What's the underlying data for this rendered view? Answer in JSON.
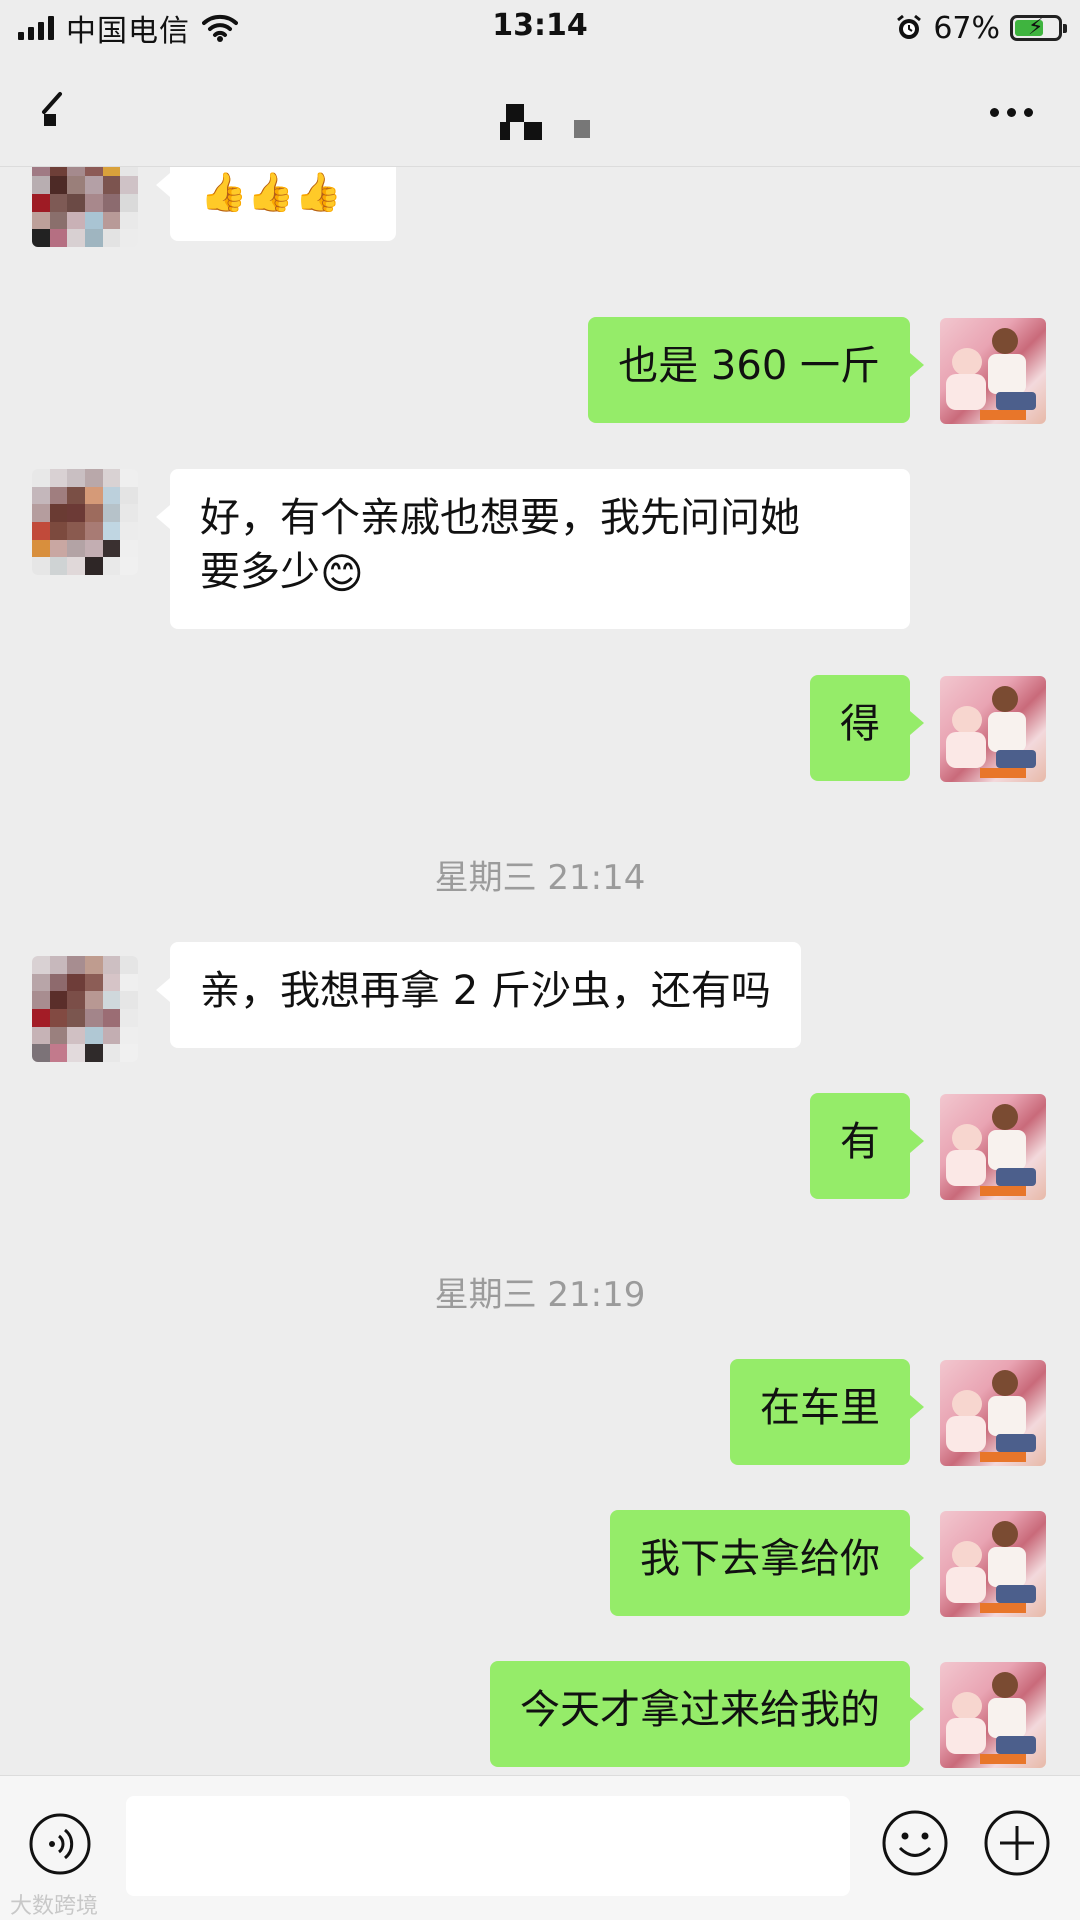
{
  "status_bar": {
    "carrier": "中国电信",
    "time": "13:14",
    "battery": "67%",
    "battery_level": 0.67,
    "icons": [
      "signal-icon",
      "wifi-icon",
      "alarm-icon",
      "battery-charging-icon"
    ]
  },
  "nav": {
    "back_icon": "back-arrow-icon",
    "more_icon": "more-icon"
  },
  "messages": [
    {
      "side": "left",
      "type": "emoji",
      "content": "👍👍👍"
    },
    {
      "side": "right",
      "text": "也是 360 一斤"
    },
    {
      "side": "left",
      "text_line1": "好，有个亲戚也想要，我先问问她",
      "text_line2": "要多少",
      "emoji": "😊"
    },
    {
      "side": "right",
      "text": "得"
    },
    {
      "timestamp": "星期三 21:14"
    },
    {
      "side": "left",
      "text": "亲，我想再拿 2 斤沙虫，还有吗"
    },
    {
      "side": "right",
      "text": "有"
    },
    {
      "timestamp": "星期三 21:19"
    },
    {
      "side": "right",
      "text": "在车里"
    },
    {
      "side": "right",
      "text": "我下去拿给你"
    },
    {
      "side": "right",
      "text": "今天才拿过来给我的"
    }
  ],
  "input_bar": {
    "voice_icon": "voice-icon",
    "emoji_icon": "emoji-icon",
    "plus_icon": "plus-icon",
    "input_value": ""
  },
  "watermark": "大数跨境",
  "colors": {
    "background": "#ededed",
    "bubble_sent": "#95ec69",
    "bubble_received": "#ffffff",
    "timestamp": "#9b9b9b"
  }
}
